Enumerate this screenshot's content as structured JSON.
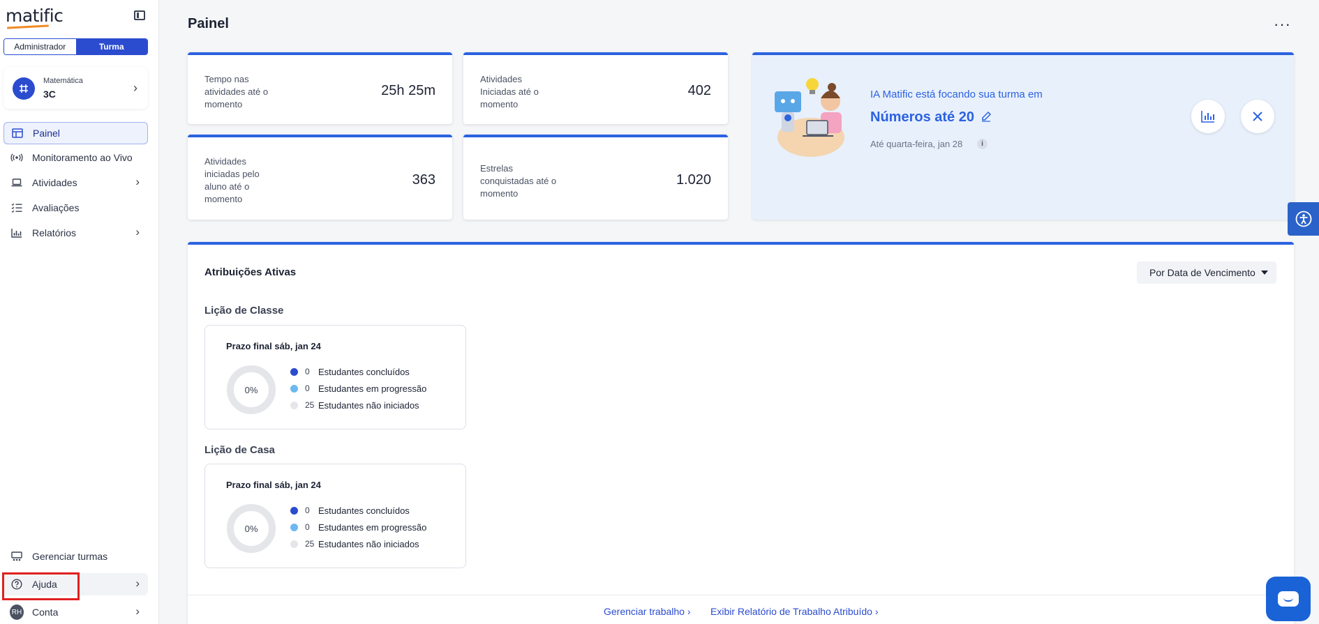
{
  "app": {
    "logo_text": "matific"
  },
  "sidebar": {
    "role_toggle": {
      "admin_label": "Administrador",
      "class_label": "Turma",
      "selected": "Turma"
    },
    "class_card": {
      "subject": "Matemática",
      "name": "3C",
      "avatar_icon": "grid-icon"
    },
    "nav": [
      {
        "label": "Painel",
        "icon": "dashboard-icon",
        "active": true,
        "has_chevron": false
      },
      {
        "label": "Monitoramento ao Vivo",
        "icon": "broadcast-icon",
        "active": false,
        "has_chevron": false
      },
      {
        "label": "Atividades",
        "icon": "laptop-icon",
        "active": false,
        "has_chevron": true
      },
      {
        "label": "Avaliações",
        "icon": "checklist-icon",
        "active": false,
        "has_chevron": false
      },
      {
        "label": "Relatórios",
        "icon": "bar-chart-icon",
        "active": false,
        "has_chevron": true
      }
    ],
    "bottom": {
      "manage_classes": "Gerenciar turmas",
      "help": "Ajuda",
      "account": "Conta",
      "account_initials": "RH"
    }
  },
  "main": {
    "title": "Painel",
    "stats": [
      {
        "label": "Tempo nas atividades até o momento",
        "value": "25h 25m"
      },
      {
        "label": "Atividades Iniciadas até o momento",
        "value": "402"
      },
      {
        "label": "Atividades iniciadas pelo aluno até o momento",
        "value": "363"
      },
      {
        "label": "Estrelas conquistadas até o momento",
        "value": "1.020"
      }
    ],
    "promo": {
      "kicker": "IA Matific está focando sua turma em",
      "topic": "Números até 20",
      "date": "Até quarta-feira, jan 28"
    },
    "assignments": {
      "title": "Atribuições Ativas",
      "sort_label": "Por Data de Vencimento",
      "sections": [
        {
          "title": "Lição de Classe",
          "deadline": "Prazo final sáb, jan 24",
          "percent": "0%",
          "legend": [
            {
              "count": "0",
              "label": "Estudantes concluídos",
              "color": "#2b4ccf"
            },
            {
              "count": "0",
              "label": "Estudantes em progressão",
              "color": "#6cb8f0"
            },
            {
              "count": "25",
              "label": "Estudantes não iniciados",
              "color": "#e4e6ea"
            }
          ]
        },
        {
          "title": "Lição de Casa",
          "deadline": "Prazo final sáb, jan 24",
          "percent": "0%",
          "legend": [
            {
              "count": "0",
              "label": "Estudantes concluídos",
              "color": "#2b4ccf"
            },
            {
              "count": "0",
              "label": "Estudantes em progressão",
              "color": "#6cb8f0"
            },
            {
              "count": "25",
              "label": "Estudantes não iniciados",
              "color": "#e4e6ea"
            }
          ]
        }
      ],
      "footer_links": [
        "Gerenciar trabalho",
        "Exibir Relatório de Trabalho Atribuído"
      ]
    }
  },
  "colors": {
    "accent": "#2b4ccf",
    "promo_bg": "#e8f0fc",
    "card_border_top": "#2b62e0"
  }
}
